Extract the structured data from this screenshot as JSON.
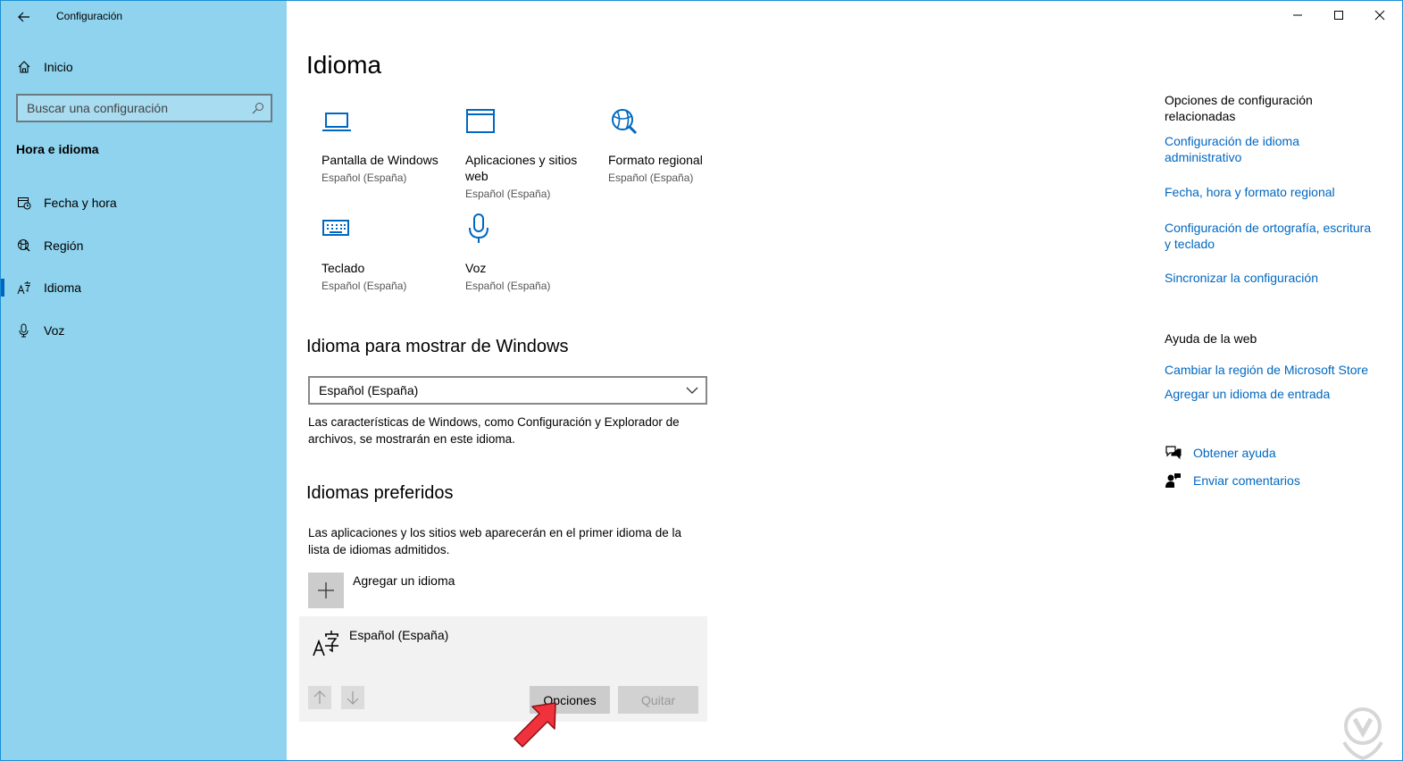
{
  "app": {
    "title": "Configuración"
  },
  "sidebar": {
    "home_label": "Inicio",
    "search_placeholder": "Buscar una configuración",
    "section_title": "Hora e idioma",
    "items": [
      {
        "label": "Fecha y hora",
        "icon": "calendar-clock-icon"
      },
      {
        "label": "Región",
        "icon": "globe-icon"
      },
      {
        "label": "Idioma",
        "icon": "language-icon",
        "active": true
      },
      {
        "label": "Voz",
        "icon": "microphone-icon"
      }
    ]
  },
  "main": {
    "title": "Idioma",
    "tiles": [
      {
        "title": "Pantalla de Windows",
        "sub": "Español (España)",
        "icon": "laptop-icon"
      },
      {
        "title": "Aplicaciones y sitios web",
        "sub": "Español (España)",
        "icon": "app-window-icon"
      },
      {
        "title": "Formato regional",
        "sub": "Español (España)",
        "icon": "globe-format-icon"
      },
      {
        "title": "Teclado",
        "sub": "Español (España)",
        "icon": "keyboard-icon"
      },
      {
        "title": "Voz",
        "sub": "Español (España)",
        "icon": "microphone-icon"
      }
    ],
    "display_language": {
      "heading": "Idioma para mostrar de Windows",
      "selected": "Español (España)",
      "description": "Las características de Windows, como Configuración y Explorador de archivos, se mostrarán en este idioma."
    },
    "preferred": {
      "heading": "Idiomas preferidos",
      "description": "Las aplicaciones y los sitios web aparecerán en el primer idioma de la lista de idiomas admitidos.",
      "add_label": "Agregar un idioma",
      "language": "Español (España)",
      "options_label": "Opciones",
      "remove_label": "Quitar"
    }
  },
  "related": {
    "heading": "Opciones de configuración relacionadas",
    "links": [
      "Configuración de idioma administrativo",
      "Fecha, hora y formato regional",
      "Configuración de ortografía, escritura y teclado",
      "Sincronizar la configuración"
    ],
    "web_heading": "Ayuda de la web",
    "web_links": [
      "Cambiar la región de Microsoft Store",
      "Agregar un idioma de entrada"
    ],
    "help": [
      {
        "label": "Obtener ayuda",
        "icon": "chat-help-icon"
      },
      {
        "label": "Enviar comentarios",
        "icon": "feedback-icon"
      }
    ]
  },
  "colors": {
    "sidebar": "#8fd3ee",
    "accent": "#0067c0",
    "annotation_arrow": "#f0323c"
  }
}
